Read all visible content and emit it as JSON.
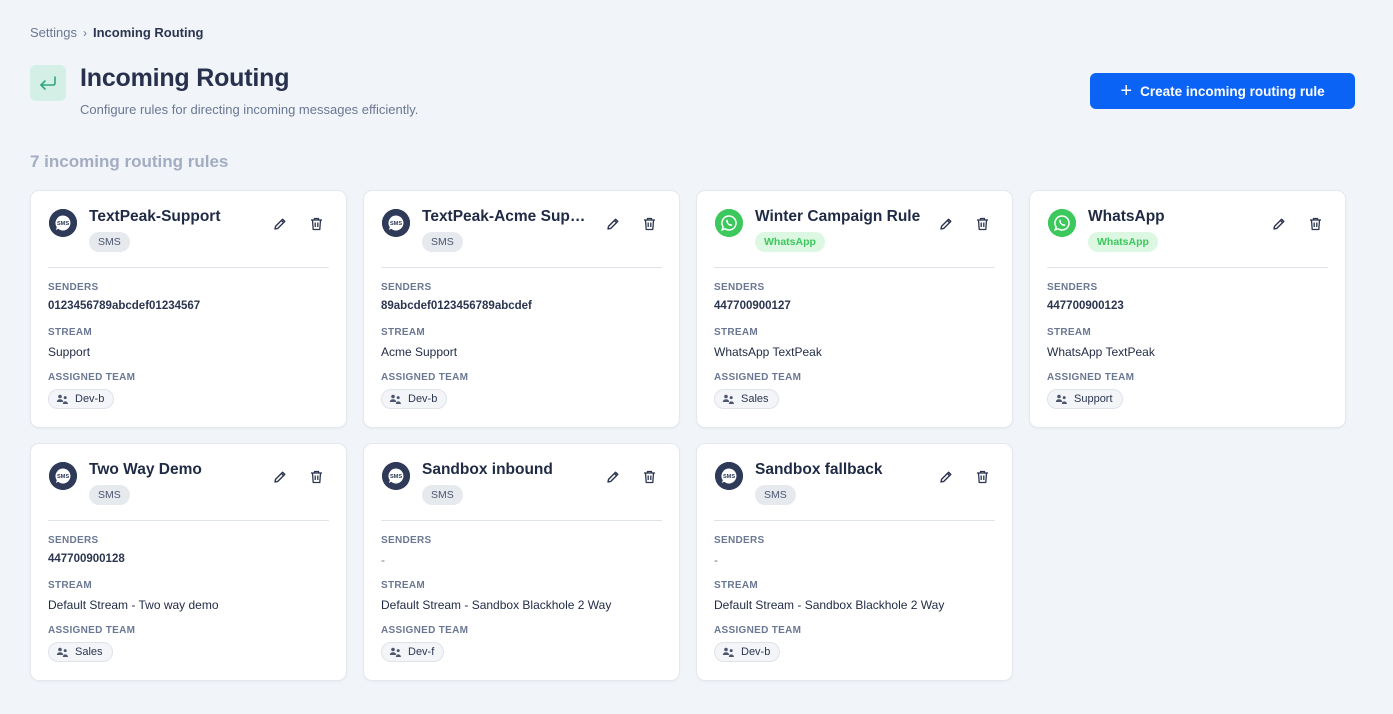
{
  "breadcrumb": {
    "parent": "Settings",
    "separator": "›",
    "current": "Incoming Routing"
  },
  "header": {
    "title": "Incoming Routing",
    "subtitle": "Configure rules for directing incoming messages efficiently.",
    "icon": "return-arrow-icon",
    "icon_color": "#2fa77e"
  },
  "create_button": {
    "plus": "+",
    "label": "Create incoming routing rule",
    "color": "#0b63f6"
  },
  "summary": {
    "count_text": "7 incoming routing rules"
  },
  "field_labels": {
    "senders": "SENDERS",
    "stream": "STREAM",
    "team": "ASSIGNED TEAM"
  },
  "rules": [
    {
      "name": "TextPeak-Support",
      "channel": "SMS",
      "channel_type": "sms",
      "senders": "0123456789abcdef01234567",
      "stream": "Support",
      "team": "Dev-b"
    },
    {
      "name": "TextPeak-Acme Support",
      "channel": "SMS",
      "channel_type": "sms",
      "senders": "89abcdef0123456789abcdef",
      "stream": "Acme Support",
      "team": "Dev-b"
    },
    {
      "name": "Winter Campaign Rule",
      "channel": "WhatsApp",
      "channel_type": "wa",
      "senders": "447700900127",
      "stream": "WhatsApp TextPeak",
      "team": "Sales"
    },
    {
      "name": "WhatsApp",
      "channel": "WhatsApp",
      "channel_type": "wa",
      "senders": "447700900123",
      "stream": "WhatsApp TextPeak",
      "team": "Support"
    },
    {
      "name": "Two Way Demo",
      "channel": "SMS",
      "channel_type": "sms",
      "senders": "447700900128",
      "stream": "Default Stream - Two way demo",
      "team": "Sales"
    },
    {
      "name": "Sandbox inbound",
      "channel": "SMS",
      "channel_type": "sms",
      "senders": "-",
      "stream": "Default Stream - Sandbox Blackhole 2 Way",
      "team": "Dev-f"
    },
    {
      "name": "Sandbox fallback",
      "channel": "SMS",
      "channel_type": "sms",
      "senders": "-",
      "stream": "Default Stream - Sandbox Blackhole 2 Way",
      "team": "Dev-b"
    }
  ],
  "colors": {
    "sms_icon": "#2e3a57",
    "whatsapp_icon": "#3cc85c",
    "accent": "#0b63f6"
  }
}
